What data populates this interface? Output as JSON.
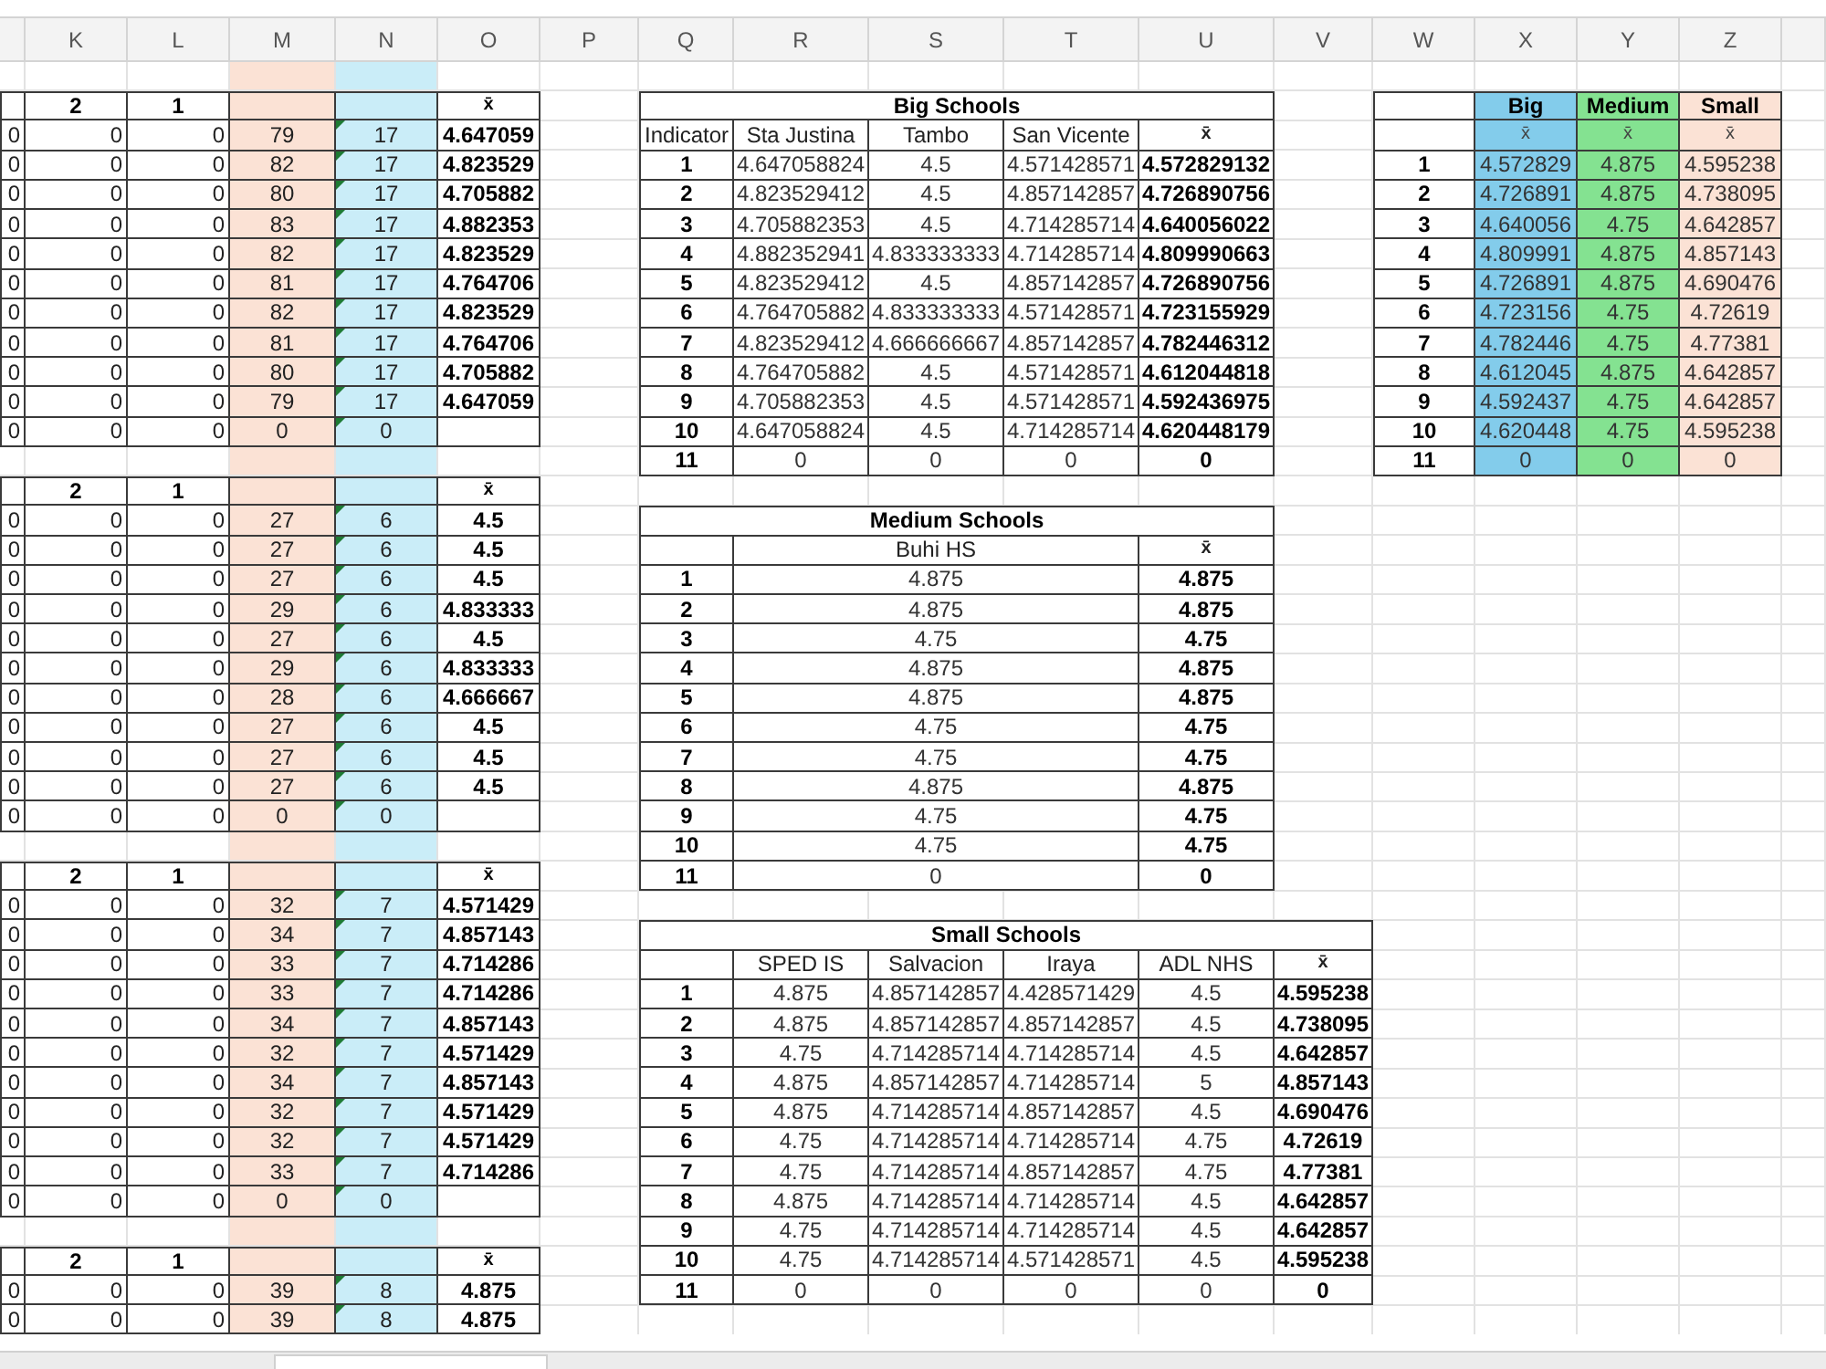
{
  "column_headers": [
    "K",
    "L",
    "M",
    "N",
    "O",
    "P",
    "Q",
    "R",
    "S",
    "T",
    "U",
    "V",
    "W",
    "X",
    "Y",
    "Z"
  ],
  "count_blocks": [
    {
      "labels": [
        "2",
        "1"
      ],
      "mean": "x̄",
      "rows": [
        [
          "0",
          "0",
          "0",
          "79",
          "17",
          "4.647059"
        ],
        [
          "0",
          "0",
          "0",
          "82",
          "17",
          "4.823529"
        ],
        [
          "0",
          "0",
          "0",
          "80",
          "17",
          "4.705882"
        ],
        [
          "0",
          "0",
          "0",
          "83",
          "17",
          "4.882353"
        ],
        [
          "0",
          "0",
          "0",
          "82",
          "17",
          "4.823529"
        ],
        [
          "0",
          "0",
          "0",
          "81",
          "17",
          "4.764706"
        ],
        [
          "0",
          "0",
          "0",
          "82",
          "17",
          "4.823529"
        ],
        [
          "0",
          "0",
          "0",
          "81",
          "17",
          "4.764706"
        ],
        [
          "0",
          "0",
          "0",
          "80",
          "17",
          "4.705882"
        ],
        [
          "0",
          "0",
          "0",
          "79",
          "17",
          "4.647059"
        ],
        [
          "0",
          "0",
          "0",
          "0",
          "0"
        ]
      ]
    },
    {
      "labels": [
        "2",
        "1"
      ],
      "mean": "x̄",
      "rows": [
        [
          "0",
          "0",
          "0",
          "27",
          "6",
          "4.5"
        ],
        [
          "0",
          "0",
          "0",
          "27",
          "6",
          "4.5"
        ],
        [
          "0",
          "0",
          "0",
          "27",
          "6",
          "4.5"
        ],
        [
          "0",
          "0",
          "0",
          "29",
          "6",
          "4.833333"
        ],
        [
          "0",
          "0",
          "0",
          "27",
          "6",
          "4.5"
        ],
        [
          "0",
          "0",
          "0",
          "29",
          "6",
          "4.833333"
        ],
        [
          "0",
          "0",
          "0",
          "28",
          "6",
          "4.666667"
        ],
        [
          "0",
          "0",
          "0",
          "27",
          "6",
          "4.5"
        ],
        [
          "0",
          "0",
          "0",
          "27",
          "6",
          "4.5"
        ],
        [
          "0",
          "0",
          "0",
          "27",
          "6",
          "4.5"
        ],
        [
          "0",
          "0",
          "0",
          "0",
          "0"
        ]
      ]
    },
    {
      "labels": [
        "2",
        "1"
      ],
      "mean": "x̄",
      "rows": [
        [
          "0",
          "0",
          "0",
          "32",
          "7",
          "4.571429"
        ],
        [
          "0",
          "0",
          "0",
          "34",
          "7",
          "4.857143"
        ],
        [
          "0",
          "0",
          "0",
          "33",
          "7",
          "4.714286"
        ],
        [
          "0",
          "0",
          "0",
          "33",
          "7",
          "4.714286"
        ],
        [
          "0",
          "0",
          "0",
          "34",
          "7",
          "4.857143"
        ],
        [
          "0",
          "0",
          "0",
          "32",
          "7",
          "4.571429"
        ],
        [
          "0",
          "0",
          "0",
          "34",
          "7",
          "4.857143"
        ],
        [
          "0",
          "0",
          "0",
          "32",
          "7",
          "4.571429"
        ],
        [
          "0",
          "0",
          "0",
          "32",
          "7",
          "4.571429"
        ],
        [
          "0",
          "0",
          "0",
          "33",
          "7",
          "4.714286"
        ],
        [
          "0",
          "0",
          "0",
          "0",
          "0"
        ]
      ]
    },
    {
      "labels": [
        "2",
        "1"
      ],
      "mean": "x̄",
      "rows": [
        [
          "0",
          "0",
          "0",
          "39",
          "8",
          "4.875"
        ],
        [
          "0",
          "0",
          "0",
          "39",
          "8",
          "4.875"
        ]
      ]
    }
  ],
  "big_schools": {
    "title": "Big Schools",
    "corner": "Indicator",
    "columns": [
      "Sta Justina",
      "Tambo",
      "San Vicente",
      "x̄"
    ],
    "rows": [
      {
        "indicator": "1",
        "values": [
          "4.647058824",
          "4.5",
          "4.571428571"
        ],
        "mean": "4.572829132"
      },
      {
        "indicator": "2",
        "values": [
          "4.823529412",
          "4.5",
          "4.857142857"
        ],
        "mean": "4.726890756"
      },
      {
        "indicator": "3",
        "values": [
          "4.705882353",
          "4.5",
          "4.714285714"
        ],
        "mean": "4.640056022"
      },
      {
        "indicator": "4",
        "values": [
          "4.882352941",
          "4.833333333",
          "4.714285714"
        ],
        "mean": "4.809990663"
      },
      {
        "indicator": "5",
        "values": [
          "4.823529412",
          "4.5",
          "4.857142857"
        ],
        "mean": "4.726890756"
      },
      {
        "indicator": "6",
        "values": [
          "4.764705882",
          "4.833333333",
          "4.571428571"
        ],
        "mean": "4.723155929"
      },
      {
        "indicator": "7",
        "values": [
          "4.823529412",
          "4.666666667",
          "4.857142857"
        ],
        "mean": "4.782446312"
      },
      {
        "indicator": "8",
        "values": [
          "4.764705882",
          "4.5",
          "4.571428571"
        ],
        "mean": "4.612044818"
      },
      {
        "indicator": "9",
        "values": [
          "4.705882353",
          "4.5",
          "4.571428571"
        ],
        "mean": "4.592436975"
      },
      {
        "indicator": "10",
        "values": [
          "4.647058824",
          "4.5",
          "4.714285714"
        ],
        "mean": "4.620448179"
      },
      {
        "indicator": "11",
        "values": [
          "0",
          "0",
          "0"
        ],
        "mean": "0"
      }
    ]
  },
  "medium_schools": {
    "title": "Medium Schools",
    "columns": [
      "Buhi HS",
      "x̄"
    ],
    "rows": [
      {
        "indicator": "1",
        "values": [
          "4.875"
        ],
        "mean": "4.875"
      },
      {
        "indicator": "2",
        "values": [
          "4.875"
        ],
        "mean": "4.875"
      },
      {
        "indicator": "3",
        "values": [
          "4.75"
        ],
        "mean": "4.75"
      },
      {
        "indicator": "4",
        "values": [
          "4.875"
        ],
        "mean": "4.875"
      },
      {
        "indicator": "5",
        "values": [
          "4.875"
        ],
        "mean": "4.875"
      },
      {
        "indicator": "6",
        "values": [
          "4.75"
        ],
        "mean": "4.75"
      },
      {
        "indicator": "7",
        "values": [
          "4.75"
        ],
        "mean": "4.75"
      },
      {
        "indicator": "8",
        "values": [
          "4.875"
        ],
        "mean": "4.875"
      },
      {
        "indicator": "9",
        "values": [
          "4.75"
        ],
        "mean": "4.75"
      },
      {
        "indicator": "10",
        "values": [
          "4.75"
        ],
        "mean": "4.75"
      },
      {
        "indicator": "11",
        "values": [
          "0"
        ],
        "mean": "0"
      }
    ]
  },
  "small_schools": {
    "title": "Small Schools",
    "columns": [
      "SPED IS",
      "Salvacion",
      "Iraya",
      "ADL NHS",
      "x̄"
    ],
    "rows": [
      {
        "indicator": "1",
        "values": [
          "4.875",
          "4.857142857",
          "4.428571429",
          "4.5"
        ],
        "mean": "4.595238"
      },
      {
        "indicator": "2",
        "values": [
          "4.875",
          "4.857142857",
          "4.857142857",
          "4.5"
        ],
        "mean": "4.738095"
      },
      {
        "indicator": "3",
        "values": [
          "4.75",
          "4.714285714",
          "4.714285714",
          "4.5"
        ],
        "mean": "4.642857"
      },
      {
        "indicator": "4",
        "values": [
          "4.875",
          "4.857142857",
          "4.714285714",
          "5"
        ],
        "mean": "4.857143"
      },
      {
        "indicator": "5",
        "values": [
          "4.875",
          "4.714285714",
          "4.857142857",
          "4.5"
        ],
        "mean": "4.690476"
      },
      {
        "indicator": "6",
        "values": [
          "4.75",
          "4.714285714",
          "4.714285714",
          "4.75"
        ],
        "mean": "4.72619"
      },
      {
        "indicator": "7",
        "values": [
          "4.75",
          "4.714285714",
          "4.857142857",
          "4.75"
        ],
        "mean": "4.77381"
      },
      {
        "indicator": "8",
        "values": [
          "4.875",
          "4.714285714",
          "4.714285714",
          "4.5"
        ],
        "mean": "4.642857"
      },
      {
        "indicator": "9",
        "values": [
          "4.75",
          "4.714285714",
          "4.714285714",
          "4.5"
        ],
        "mean": "4.642857"
      },
      {
        "indicator": "10",
        "values": [
          "4.75",
          "4.714285714",
          "4.571428571",
          "4.5"
        ],
        "mean": "4.595238"
      },
      {
        "indicator": "11",
        "values": [
          "0",
          "0",
          "0",
          "0"
        ],
        "mean": "0"
      }
    ]
  },
  "summary": {
    "columns": [
      {
        "label": "Big",
        "sub": "x̄",
        "color": "#83cceb"
      },
      {
        "label": "Medium",
        "sub": "x̄",
        "color": "#84e291"
      },
      {
        "label": "Small",
        "sub": "x̄",
        "color": "#fbe2d5"
      }
    ],
    "rows": [
      {
        "indicator": "1",
        "values": [
          "4.572829",
          "4.875",
          "4.595238"
        ]
      },
      {
        "indicator": "2",
        "values": [
          "4.726891",
          "4.875",
          "4.738095"
        ]
      },
      {
        "indicator": "3",
        "values": [
          "4.640056",
          "4.75",
          "4.642857"
        ]
      },
      {
        "indicator": "4",
        "values": [
          "4.809991",
          "4.875",
          "4.857143"
        ]
      },
      {
        "indicator": "5",
        "values": [
          "4.726891",
          "4.875",
          "4.690476"
        ]
      },
      {
        "indicator": "6",
        "values": [
          "4.723156",
          "4.75",
          "4.72619"
        ]
      },
      {
        "indicator": "7",
        "values": [
          "4.782446",
          "4.75",
          "4.77381"
        ]
      },
      {
        "indicator": "8",
        "values": [
          "4.612045",
          "4.875",
          "4.642857"
        ]
      },
      {
        "indicator": "9",
        "values": [
          "4.592437",
          "4.75",
          "4.642857"
        ]
      },
      {
        "indicator": "10",
        "values": [
          "4.620448",
          "4.75",
          "4.595238"
        ]
      },
      {
        "indicator": "11",
        "values": [
          "0",
          "0",
          "0"
        ]
      }
    ]
  }
}
